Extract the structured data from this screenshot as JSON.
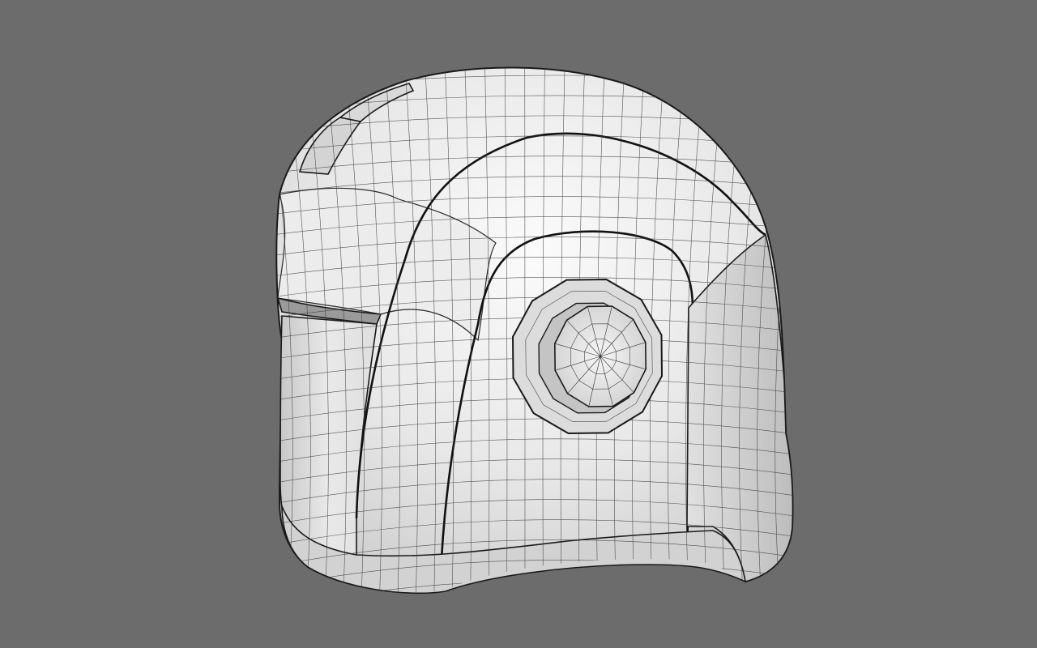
{
  "viewport": {
    "background_color": "#6c6c6c",
    "model": {
      "subject": "helmet",
      "render_style": "wireframe-over-shaded",
      "surface_color": "#e9e9e9",
      "edge_color": "#1a1a1a",
      "wire_color": "#3a3a3a"
    }
  }
}
